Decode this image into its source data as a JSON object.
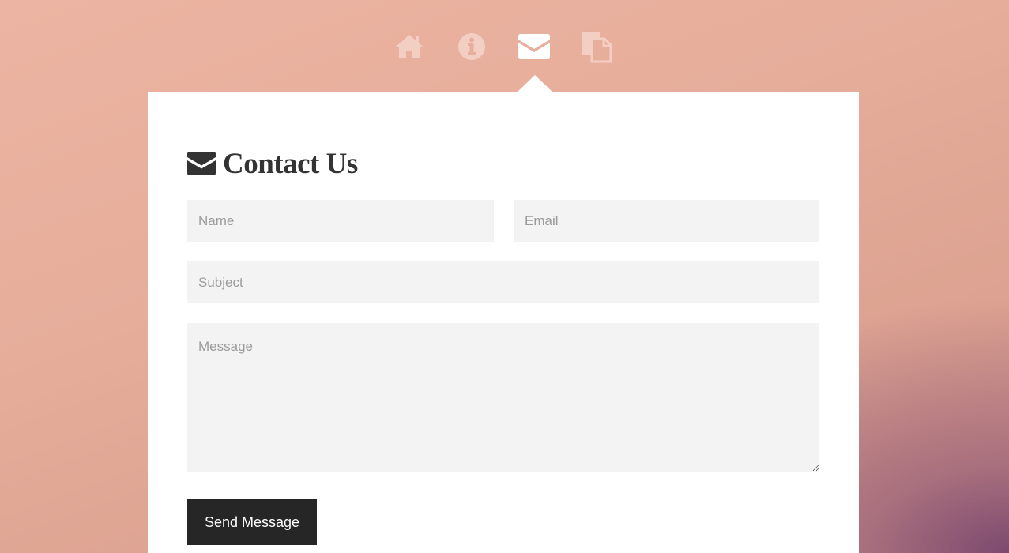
{
  "nav": {
    "items": [
      {
        "icon": "home-icon",
        "active": false
      },
      {
        "icon": "info-icon",
        "active": false
      },
      {
        "icon": "envelope-icon",
        "active": true
      },
      {
        "icon": "documents-icon",
        "active": false
      }
    ]
  },
  "contact": {
    "title": "Contact Us",
    "name_placeholder": "Name",
    "email_placeholder": "Email",
    "subject_placeholder": "Subject",
    "message_placeholder": "Message",
    "send_label": "Send Message"
  },
  "colors": {
    "panel": "#ffffff",
    "field_bg": "#f3f3f3",
    "button_bg": "#262626",
    "heading": "#333333",
    "nav_icon_inactive": "#f3cfc3",
    "nav_icon_active": "#ffffff"
  }
}
